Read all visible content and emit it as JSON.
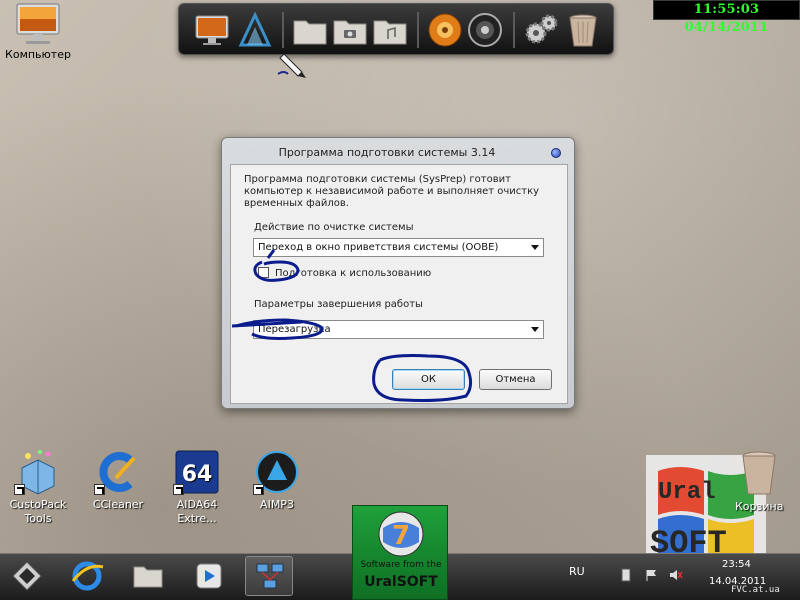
{
  "clock": {
    "text": "11:55:03  04/14/2011"
  },
  "desktop_icons": {
    "computer_label": "Компьютер",
    "trash_label": "Корзина"
  },
  "dock": {
    "items": [
      "computer-icon",
      "tools-icon",
      "folder-icon",
      "camera-folder-icon",
      "music-folder-icon",
      "media-player-icon",
      "speaker-icon",
      "settings-gears-icon",
      "trash-icon"
    ]
  },
  "dialog": {
    "title": "Программа подготовки системы 3.14",
    "description": "Программа подготовки системы (SysPrep) готовит компьютер к независимой работе и выполняет очистку временных файлов.",
    "cleanup_label": "Действие по очистке системы",
    "cleanup_value": "Переход в окно приветствия системы (OOBE)",
    "generalize_label": "Подготовка к использованию",
    "generalize_checked": false,
    "shutdown_label": "Параметры завершения работы",
    "shutdown_value": "Перезагрузка",
    "ok_label": "ОК",
    "cancel_label": "Отмена"
  },
  "bottom_icons": [
    {
      "label": "CustoPack Tools"
    },
    {
      "label": "CCleaner"
    },
    {
      "label": "AIDA64 Extre..."
    },
    {
      "label": "AIMP3"
    }
  ],
  "promo": {
    "number": "7",
    "line1": "Software from the",
    "line2": "UralSOFT"
  },
  "watermark": {
    "line1": "Ural",
    "line2": "SOFT"
  },
  "taskbar": {
    "lang": "RU",
    "time": "23:54",
    "date": "14.04.2011"
  },
  "site_watermark": "FVC.at.ua",
  "colors": {
    "clock_text": "#2cff2c",
    "scribble": "#0b1c8c",
    "promo_green": "#1ea13a"
  }
}
